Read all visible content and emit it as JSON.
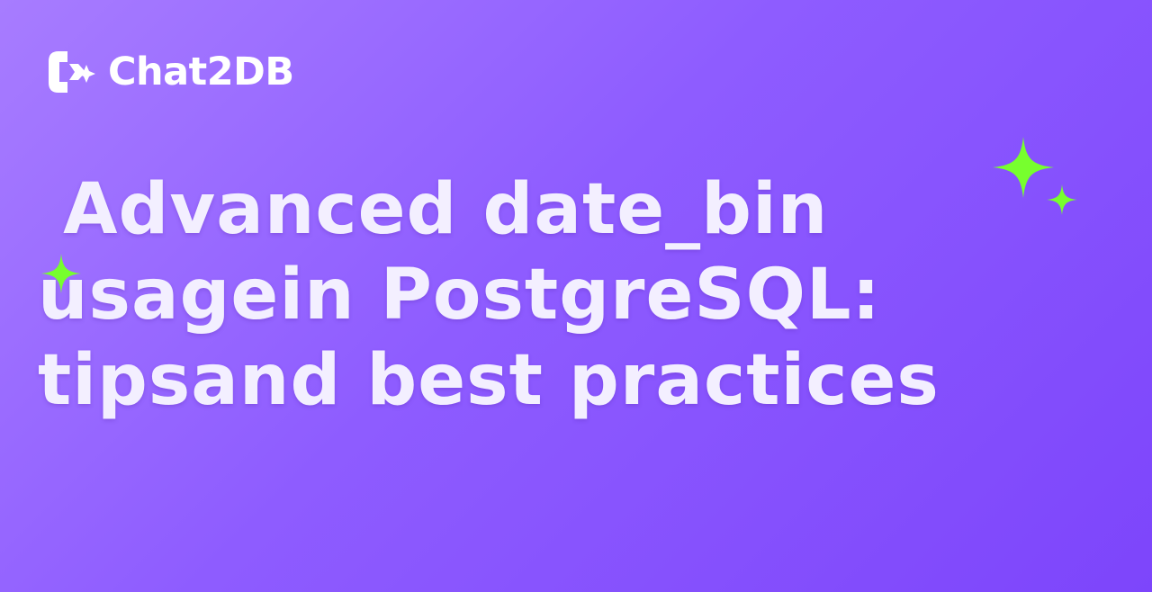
{
  "brand": {
    "name": "Chat2DB",
    "logo_icon": "chat2db-logo-icon"
  },
  "headline": {
    "lines": [
      " Advanced date_bin",
      "usagein PostgreSQL:",
      "tipsand best practices"
    ]
  },
  "decorations": {
    "sparkle_icon": "sparkle-icon",
    "sparkle_color": "#77ff2e",
    "text_color": "#f3efff"
  },
  "colors": {
    "gradient_start": "#a77cff",
    "gradient_mid": "#8e5cff",
    "gradient_end": "#7d45fb"
  }
}
